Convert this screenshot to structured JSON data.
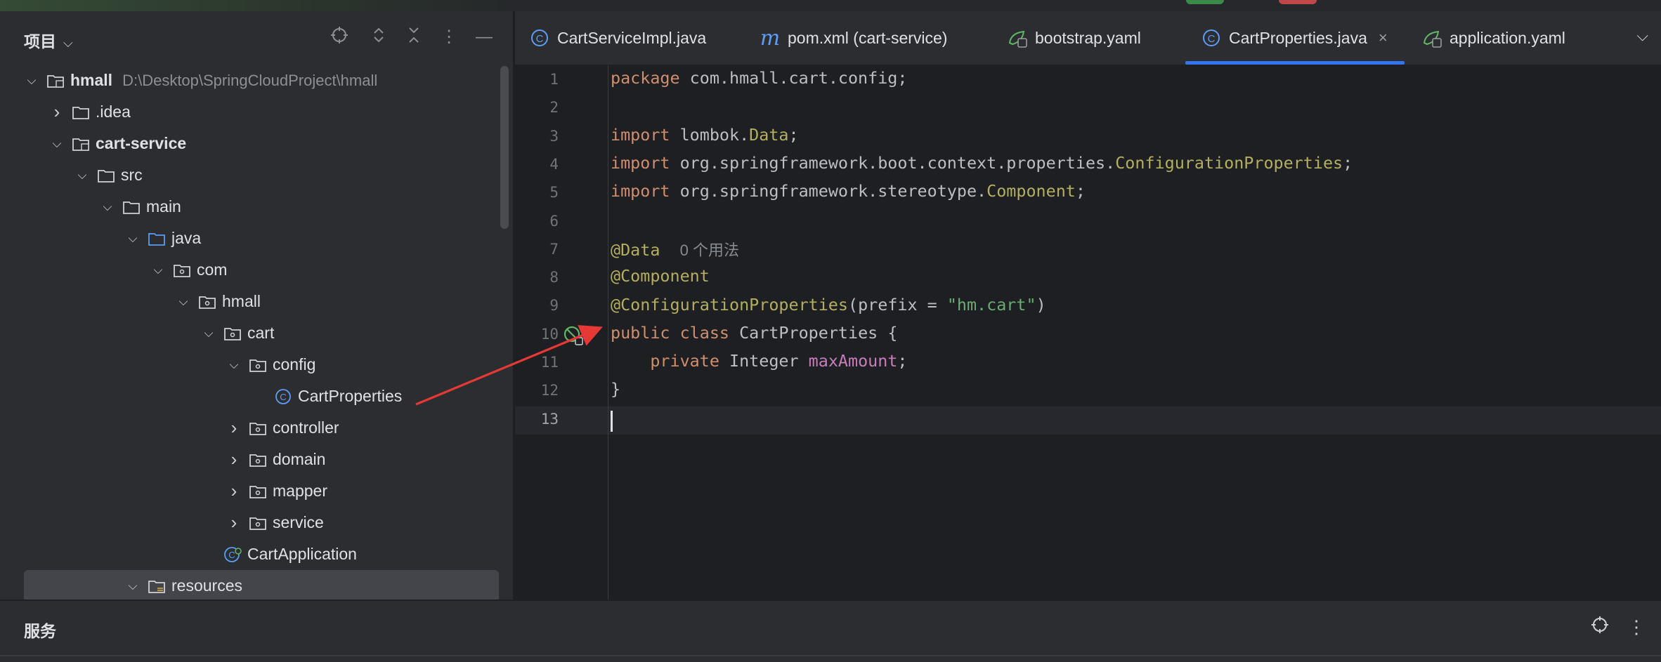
{
  "project_panel": {
    "title": "项目",
    "tree": [
      {
        "label": "hmall",
        "path": "D:\\Desktop\\SpringCloudProject\\hmall",
        "bold": true,
        "expanded": true,
        "icon": "module-folder-icon"
      },
      {
        "label": ".idea",
        "expanded": false,
        "icon": "folder-icon"
      },
      {
        "label": "cart-service",
        "bold": true,
        "expanded": true,
        "icon": "module-folder-icon"
      },
      {
        "label": "src",
        "expanded": true,
        "icon": "folder-icon"
      },
      {
        "label": "main",
        "expanded": true,
        "icon": "folder-icon"
      },
      {
        "label": "java",
        "expanded": true,
        "icon": "source-folder-icon"
      },
      {
        "label": "com",
        "expanded": true,
        "icon": "package-icon"
      },
      {
        "label": "hmall",
        "expanded": true,
        "icon": "package-icon"
      },
      {
        "label": "cart",
        "expanded": true,
        "icon": "package-icon"
      },
      {
        "label": "config",
        "expanded": true,
        "icon": "package-icon"
      },
      {
        "label": "CartProperties",
        "icon": "class-icon"
      },
      {
        "label": "controller",
        "expanded": false,
        "icon": "package-icon"
      },
      {
        "label": "domain",
        "expanded": false,
        "icon": "package-icon"
      },
      {
        "label": "mapper",
        "expanded": false,
        "icon": "package-icon"
      },
      {
        "label": "service",
        "expanded": false,
        "icon": "package-icon"
      },
      {
        "label": "CartApplication",
        "icon": "spring-boot-class-icon"
      },
      {
        "label": "resources",
        "expanded": true,
        "selected": true,
        "icon": "resources-folder-icon"
      }
    ]
  },
  "tabs": [
    {
      "label": "CartServiceImpl.java",
      "icon": "class-icon"
    },
    {
      "label": "pom.xml (cart-service)",
      "icon": "maven-icon"
    },
    {
      "label": "bootstrap.yaml",
      "icon": "spring-yaml-icon"
    },
    {
      "label": "CartProperties.java",
      "icon": "class-icon",
      "active": true,
      "close": "×"
    },
    {
      "label": "application.yaml",
      "icon": "spring-yaml-icon"
    }
  ],
  "editor": {
    "line_numbers": [
      "1",
      "2",
      "3",
      "4",
      "5",
      "6",
      "7",
      "8",
      "9",
      "10",
      "11",
      "12",
      "13"
    ],
    "lines": {
      "l1": {
        "kw": "package",
        "rest": " com.hmall.cart.config;"
      },
      "l3": {
        "kw": "import",
        "pre": " lombok.",
        "cls": "Data",
        "end": ";"
      },
      "l4": {
        "kw": "import",
        "pre": " org.springframework.boot.context.properties.",
        "cls": "ConfigurationProperties",
        "end": ";"
      },
      "l5": {
        "kw": "import",
        "pre": " org.springframework.stereotype.",
        "cls": "Component",
        "end": ";"
      },
      "l7": {
        "ann": "@Data",
        "hint": "0 个用法"
      },
      "l8": {
        "ann": "@Component"
      },
      "l9": {
        "ann": "@ConfigurationProperties",
        "open": "(prefix = ",
        "str": "\"hm.cart\"",
        "close": ")"
      },
      "l10": {
        "kw1": "public",
        "kw2": "class",
        "rest": " CartProperties {"
      },
      "l11": {
        "indent": "    ",
        "kw": "private",
        "type": " Integer ",
        "fld": "maxAmount",
        "end": ";"
      },
      "l12": {
        "rest": "}"
      }
    }
  },
  "services_panel": {
    "title": "服务"
  },
  "colors": {
    "accent": "#3574f0",
    "annotation_arrow": "#e53935"
  }
}
